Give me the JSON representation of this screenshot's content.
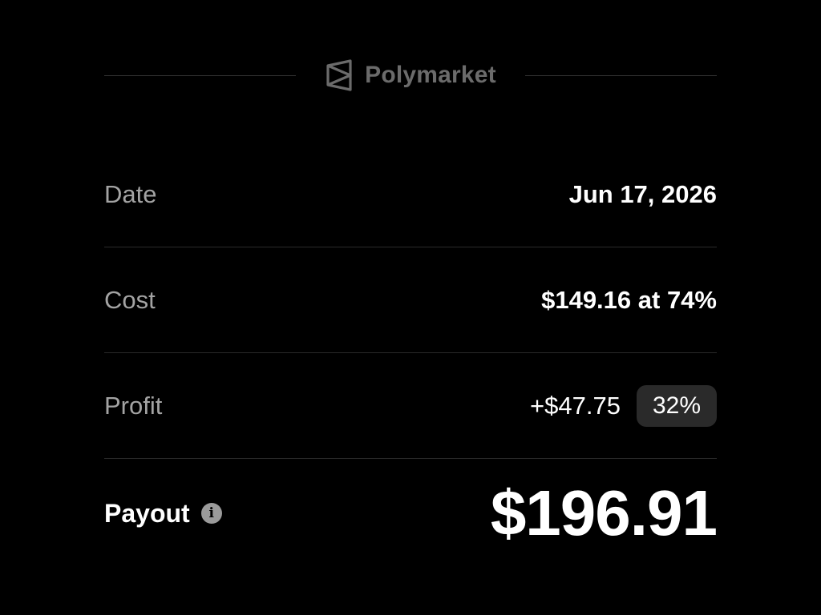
{
  "brand": {
    "name": "Polymarket",
    "logo_icon": "polymarket-logo-icon",
    "color": "#6b6b6b"
  },
  "rows": {
    "date": {
      "label": "Date",
      "value": "Jun 17, 2026"
    },
    "cost": {
      "label": "Cost",
      "value": "$149.16 at 74%"
    },
    "profit": {
      "label": "Profit",
      "amount": "+$47.75",
      "percent": "32%"
    },
    "payout": {
      "label": "Payout",
      "value": "$196.91",
      "info_icon": "info-icon",
      "info_glyph": "i"
    }
  },
  "colors": {
    "background": "#000000",
    "label": "#a3a3a3",
    "value": "#ffffff",
    "badge_bg": "#2a2a2a",
    "divider": "#2a2a2a"
  }
}
